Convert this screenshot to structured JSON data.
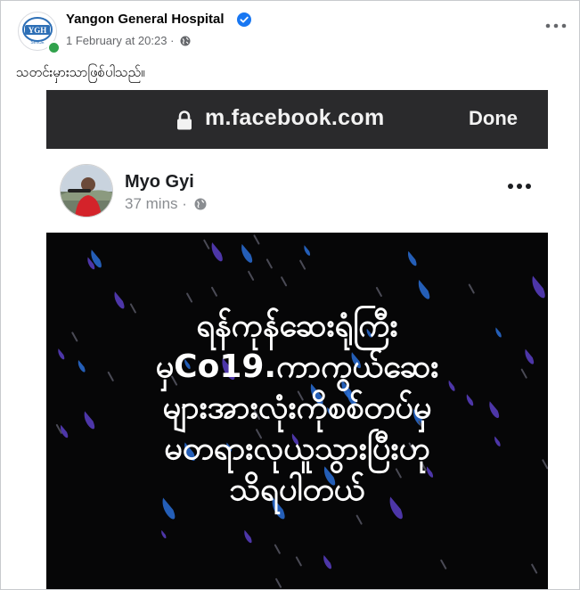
{
  "post": {
    "page_name": "Yangon General Hospital",
    "timestamp": "1 February at 20:23",
    "separator": "·",
    "caption": "သတင်းမှားသာဖြစ်ပါသည်။",
    "logo_text": "YGH",
    "logo_subtext": "SINCE",
    "icons": {
      "verified": "verified-badge-icon",
      "audience": "globe-icon",
      "more": "more-options-icon",
      "online": "online-status-dot"
    }
  },
  "screenshot": {
    "browser": {
      "url": "m.facebook.com",
      "done_label": "Done",
      "lock_icon": "lock-icon"
    },
    "inner_post": {
      "author": "Myo Gyi",
      "time": "37 mins",
      "separator": "·",
      "icons": {
        "audience": "globe-icon",
        "more": "more-options-icon"
      }
    },
    "image_text_lines": [
      "ရန်ကုန်ဆေးရုံကြီး",
      "မှCo19.ကာကွယ်ဆေး",
      "များအားလုံးကိုစစ်တပ်မှ",
      "မတရားလုယူသွားပြီးဟု",
      "သိရပါတယ်"
    ]
  },
  "colors": {
    "page_bg": "#ffffff",
    "secondary_text": "#65676b",
    "verified_blue": "#1877f2",
    "online_green": "#31a24c",
    "browser_bar": "#2a2a2c",
    "image_bg": "#060607",
    "raindrop_purple": "#5b3fc4",
    "raindrop_blue": "#2a6fd6"
  }
}
